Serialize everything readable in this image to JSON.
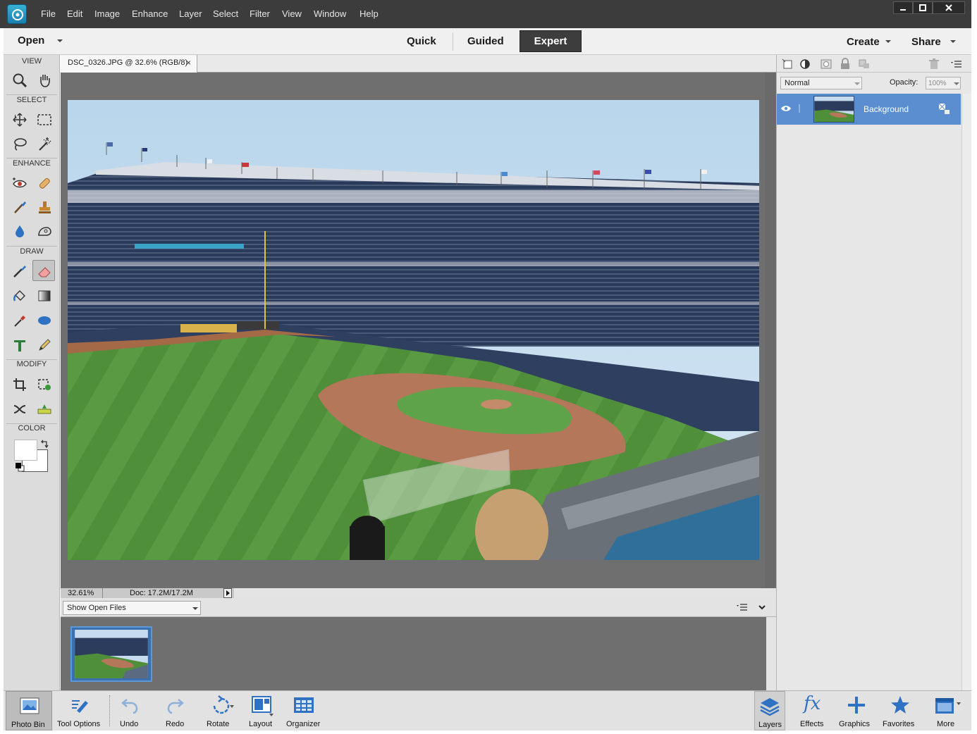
{
  "menubar": {
    "items": [
      "File",
      "Edit",
      "Image",
      "Enhance",
      "Layer",
      "Select",
      "Filter",
      "View",
      "Window",
      "Help"
    ]
  },
  "modebar": {
    "open_label": "Open",
    "tabs": [
      "Quick",
      "Guided",
      "Expert"
    ],
    "active_tab": "Expert",
    "create_label": "Create",
    "share_label": "Share"
  },
  "toolbox": {
    "sections": [
      "VIEW",
      "SELECT",
      "ENHANCE",
      "DRAW",
      "MODIFY",
      "COLOR"
    ],
    "selected_tool": "eraser-tool"
  },
  "document": {
    "tab_title": "DSC_0326.JPG @ 32.6% (RGB/8)",
    "close_glyph": "×",
    "zoom": "32.61%",
    "doc_size": "Doc: 17.2M/17.2M"
  },
  "photo_bin": {
    "select_value": "Show Open Files"
  },
  "layers_panel": {
    "blend_mode": "Normal",
    "opacity_label": "Opacity:",
    "opacity_value": "100%",
    "layers": [
      "Background"
    ]
  },
  "taskbar": {
    "left": [
      "Photo Bin",
      "Tool Options",
      "Undo",
      "Redo",
      "Rotate",
      "Layout",
      "Organizer"
    ],
    "right": [
      "Layers",
      "Effects",
      "Graphics",
      "Favorites",
      "More"
    ],
    "effects_glyph": "fx"
  },
  "colors": {
    "menubar_bg": "#3c3c3c",
    "accent_blue": "#5a8ed0",
    "workspace_gray": "#6f6f6f",
    "icon_blue": "#2f72c4"
  }
}
